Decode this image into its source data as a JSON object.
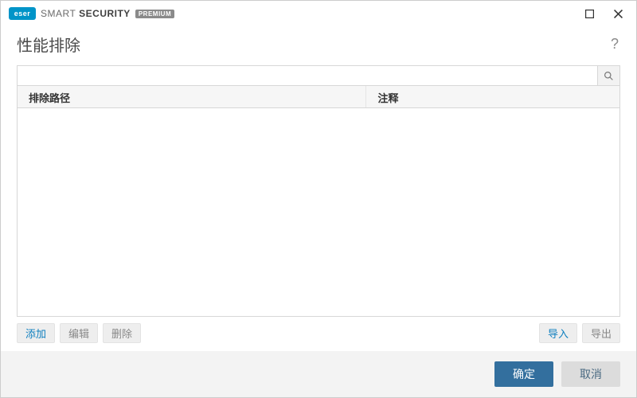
{
  "brand": {
    "logo_text": "eser",
    "name_light": "SMART",
    "name_strong": "SECURITY",
    "badge": "PREMIUM"
  },
  "header": {
    "title": "性能排除",
    "help_label": "?"
  },
  "search": {
    "value": "",
    "placeholder": ""
  },
  "table": {
    "columns": {
      "path": "排除路径",
      "comment": "注释"
    },
    "rows": []
  },
  "actions": {
    "add": "添加",
    "edit": "编辑",
    "delete": "删除",
    "import": "导入",
    "export": "导出"
  },
  "footer": {
    "ok": "确定",
    "cancel": "取消"
  }
}
